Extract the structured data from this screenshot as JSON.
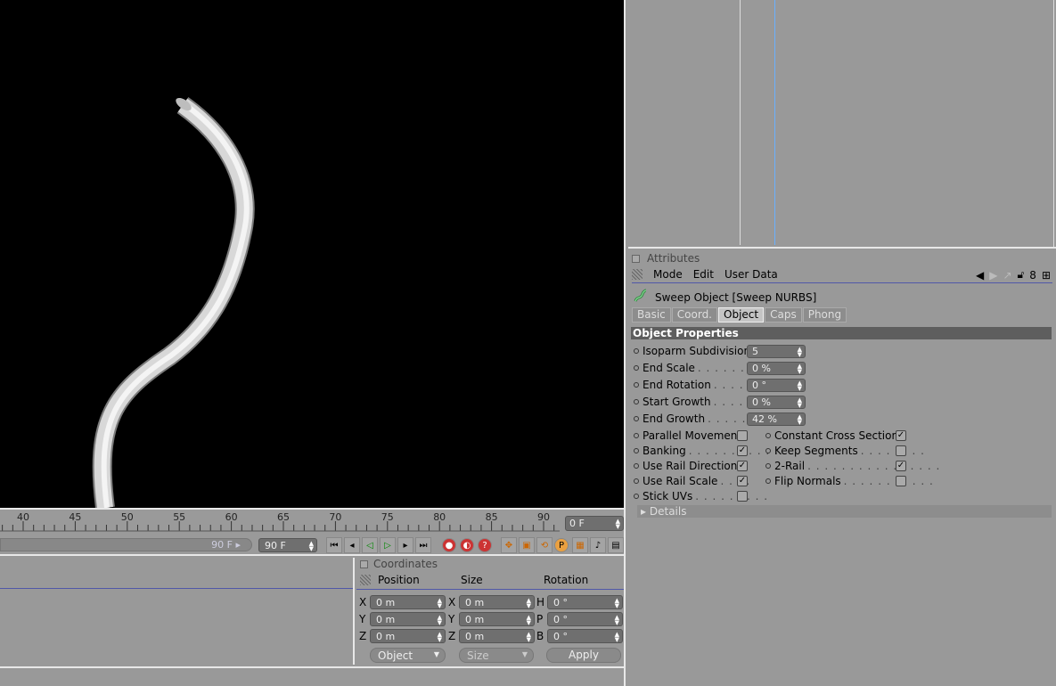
{
  "timeline": {
    "ticks": [
      "40",
      "45",
      "50",
      "55",
      "60",
      "65",
      "70",
      "75",
      "80",
      "85",
      "90"
    ],
    "current_frame": "0 F"
  },
  "transport": {
    "range_end_label": "90 F",
    "end_frame": "90 F"
  },
  "coordinates": {
    "title": "Coordinates",
    "headers": {
      "position": "Position",
      "size": "Size",
      "rotation": "Rotation"
    },
    "rows": [
      {
        "pos_axis": "X",
        "pos": "0 m",
        "size_axis": "X",
        "size": "0 m",
        "rot_axis": "H",
        "rot": "0 °"
      },
      {
        "pos_axis": "Y",
        "pos": "0 m",
        "size_axis": "Y",
        "size": "0 m",
        "rot_axis": "P",
        "rot": "0 °"
      },
      {
        "pos_axis": "Z",
        "pos": "0 m",
        "size_axis": "Z",
        "size": "0 m",
        "rot_axis": "B",
        "rot": "0 °"
      }
    ],
    "mode_dropdown": "Object",
    "size_dropdown": "Size",
    "apply_label": "Apply"
  },
  "attributes": {
    "title": "Attributes",
    "menu": {
      "mode": "Mode",
      "edit": "Edit",
      "user_data": "User Data"
    },
    "object_title": "Sweep Object [Sweep NURBS]",
    "tabs": [
      "Basic",
      "Coord.",
      "Object",
      "Caps",
      "Phong"
    ],
    "active_tab": "Object",
    "section": "Object Properties",
    "numeric_props": [
      {
        "label": "Isoparm Subdivision",
        "dots": "",
        "value": "5"
      },
      {
        "label": "End Scale",
        "dots": ". . . . . . . . .",
        "value": "0 %"
      },
      {
        "label": "End Rotation",
        "dots": ". . . . . . .",
        "value": "0 °"
      },
      {
        "label": "Start Growth",
        "dots": ". . . . . . .",
        "value": "0 %"
      },
      {
        "label": "End Growth",
        "dots": ". . . . . . . .",
        "value": "42 %"
      }
    ],
    "left_checks": [
      {
        "label": "Parallel Movement",
        "dots": "",
        "checked": ""
      },
      {
        "label": "Banking",
        "dots": ". . . . . . . . . . .",
        "checked": "✓"
      },
      {
        "label": "Use Rail Direction",
        "dots": "",
        "checked": "✓"
      },
      {
        "label": "Use Rail Scale",
        "dots": ". . . .",
        "checked": "✓"
      },
      {
        "label": "Stick UVs",
        "dots": ". . . . . . . . .",
        "checked": ""
      }
    ],
    "right_checks": [
      {
        "label": "Constant Cross Section",
        "dots": "",
        "checked": "✓"
      },
      {
        "label": "Keep Segments",
        "dots": ". . . . . . . .",
        "checked": ""
      },
      {
        "label": "2-Rail",
        "dots": ". . . . . . . . . . . . . . . .",
        "checked": "✓"
      },
      {
        "label": "Flip Normals",
        "dots": ". . . . . . . . . . .",
        "checked": ""
      }
    ],
    "details_label": "Details"
  },
  "colors": {
    "viewport_bg": "#000000",
    "panel_bg": "#999999",
    "section_bar": "#5e5e5e"
  }
}
